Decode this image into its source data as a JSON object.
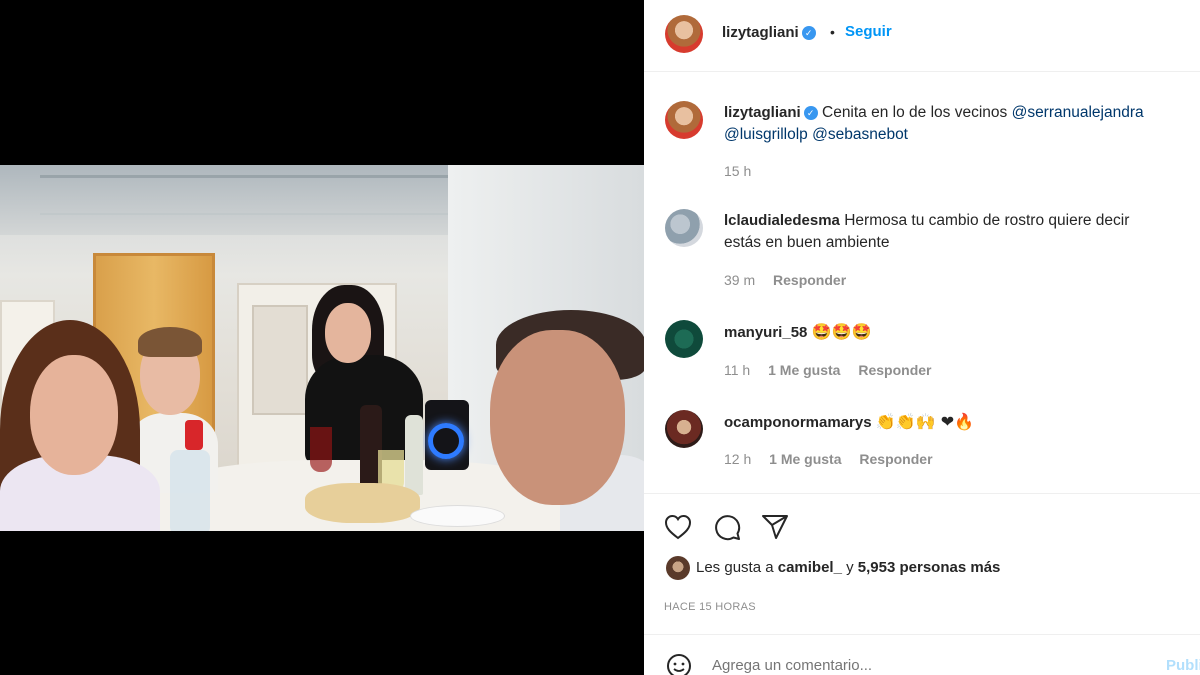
{
  "post": {
    "author": "lizytagliani",
    "follow_label": "Seguir",
    "separator": "•"
  },
  "caption": {
    "username": "lizytagliani",
    "text": "Cenita en lo de los vecinos",
    "mentions": [
      "@serranualejandra",
      "@luisgrillolp",
      "@sebasnebot"
    ],
    "time": "15 h"
  },
  "comments": [
    {
      "username": "lclaudialedesma",
      "text_line1": "Hermosa tu cambio de rostro quiere decir",
      "text_line2": "estás en buen ambiente",
      "time": "39 m",
      "reply_label": "Responder"
    },
    {
      "username": "manyuri_58",
      "emojis": "🤩🤩🤩",
      "time": "11 h",
      "likes_label": "1 Me gusta",
      "reply_label": "Responder"
    },
    {
      "username": "ocamponormamarys",
      "emojis": "👏👏🙌 ❤🔥",
      "time": "12 h",
      "likes_label": "1 Me gusta",
      "reply_label": "Responder"
    }
  ],
  "likes": {
    "prefix": "Les gusta a",
    "user": "camibel_",
    "connector": "y",
    "others": "5,953 personas más"
  },
  "posted_ago": "HACE 15 HORAS",
  "add_comment": {
    "placeholder": "Agrega un comentario...",
    "post_label": "Publicar"
  },
  "icons": {
    "like": "heart-icon",
    "comment": "comment-icon",
    "share": "share-icon",
    "emoji": "emoji-icon"
  },
  "colors": {
    "link": "#0095f6",
    "mention": "#00376b",
    "muted": "#8e8e8e",
    "verified": "#3897f0"
  }
}
